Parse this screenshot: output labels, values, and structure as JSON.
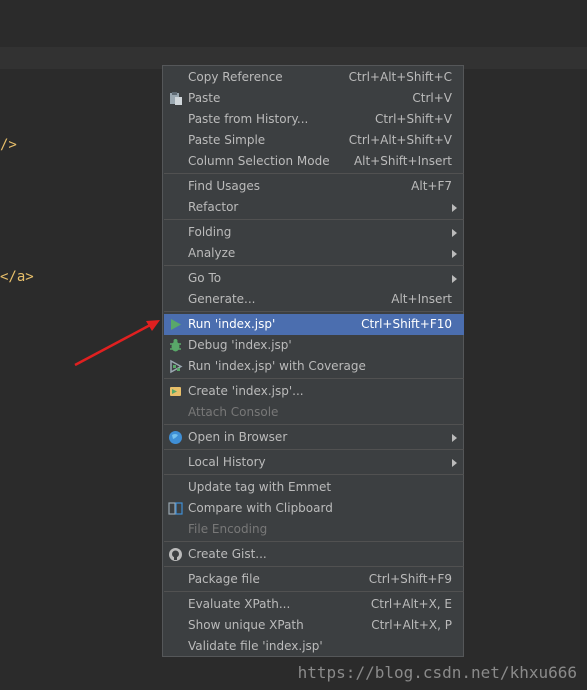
{
  "editor": {
    "code_line_1": "/>",
    "code_line_2": "</a>"
  },
  "menu": {
    "items": [
      {
        "label": "Copy Reference",
        "shortcut": "Ctrl+Alt+Shift+C"
      },
      {
        "label": "Paste",
        "shortcut": "Ctrl+V",
        "icon": "paste-icon"
      },
      {
        "label": "Paste from History...",
        "shortcut": "Ctrl+Shift+V"
      },
      {
        "label": "Paste Simple",
        "shortcut": "Ctrl+Alt+Shift+V"
      },
      {
        "label": "Column Selection Mode",
        "shortcut": "Alt+Shift+Insert"
      },
      {
        "label": "Find Usages",
        "shortcut": "Alt+F7"
      },
      {
        "label": "Refactor",
        "submenu": true
      },
      {
        "label": "Folding",
        "submenu": true
      },
      {
        "label": "Analyze",
        "submenu": true
      },
      {
        "label": "Go To",
        "submenu": true
      },
      {
        "label": "Generate...",
        "shortcut": "Alt+Insert"
      },
      {
        "label": "Run 'index.jsp'",
        "shortcut": "Ctrl+Shift+F10",
        "icon": "run-icon",
        "selected": true
      },
      {
        "label": "Debug 'index.jsp'",
        "icon": "debug-icon"
      },
      {
        "label": "Run 'index.jsp' with Coverage",
        "icon": "coverage-icon"
      },
      {
        "label": "Create 'index.jsp'...",
        "icon": "create-config-icon"
      },
      {
        "label": "Attach Console",
        "disabled": true
      },
      {
        "label": "Open in Browser",
        "submenu": true,
        "icon": "globe-icon"
      },
      {
        "label": "Local History",
        "submenu": true
      },
      {
        "label": "Update tag with Emmet"
      },
      {
        "label": "Compare with Clipboard",
        "icon": "compare-icon"
      },
      {
        "label": "File Encoding",
        "disabled": true
      },
      {
        "label": "Create Gist...",
        "icon": "github-icon"
      },
      {
        "label": "Package file",
        "shortcut": "Ctrl+Shift+F9"
      },
      {
        "label": "Evaluate XPath...",
        "shortcut": "Ctrl+Alt+X, E"
      },
      {
        "label": "Show unique XPath",
        "shortcut": "Ctrl+Alt+X, P"
      },
      {
        "label": "Validate file 'index.jsp'"
      }
    ]
  },
  "colors": {
    "menu_bg": "#3c3f41",
    "selection": "#4b6eaf",
    "annotation_arrow": "#e02020"
  },
  "watermark": "https://blog.csdn.net/khxu666"
}
